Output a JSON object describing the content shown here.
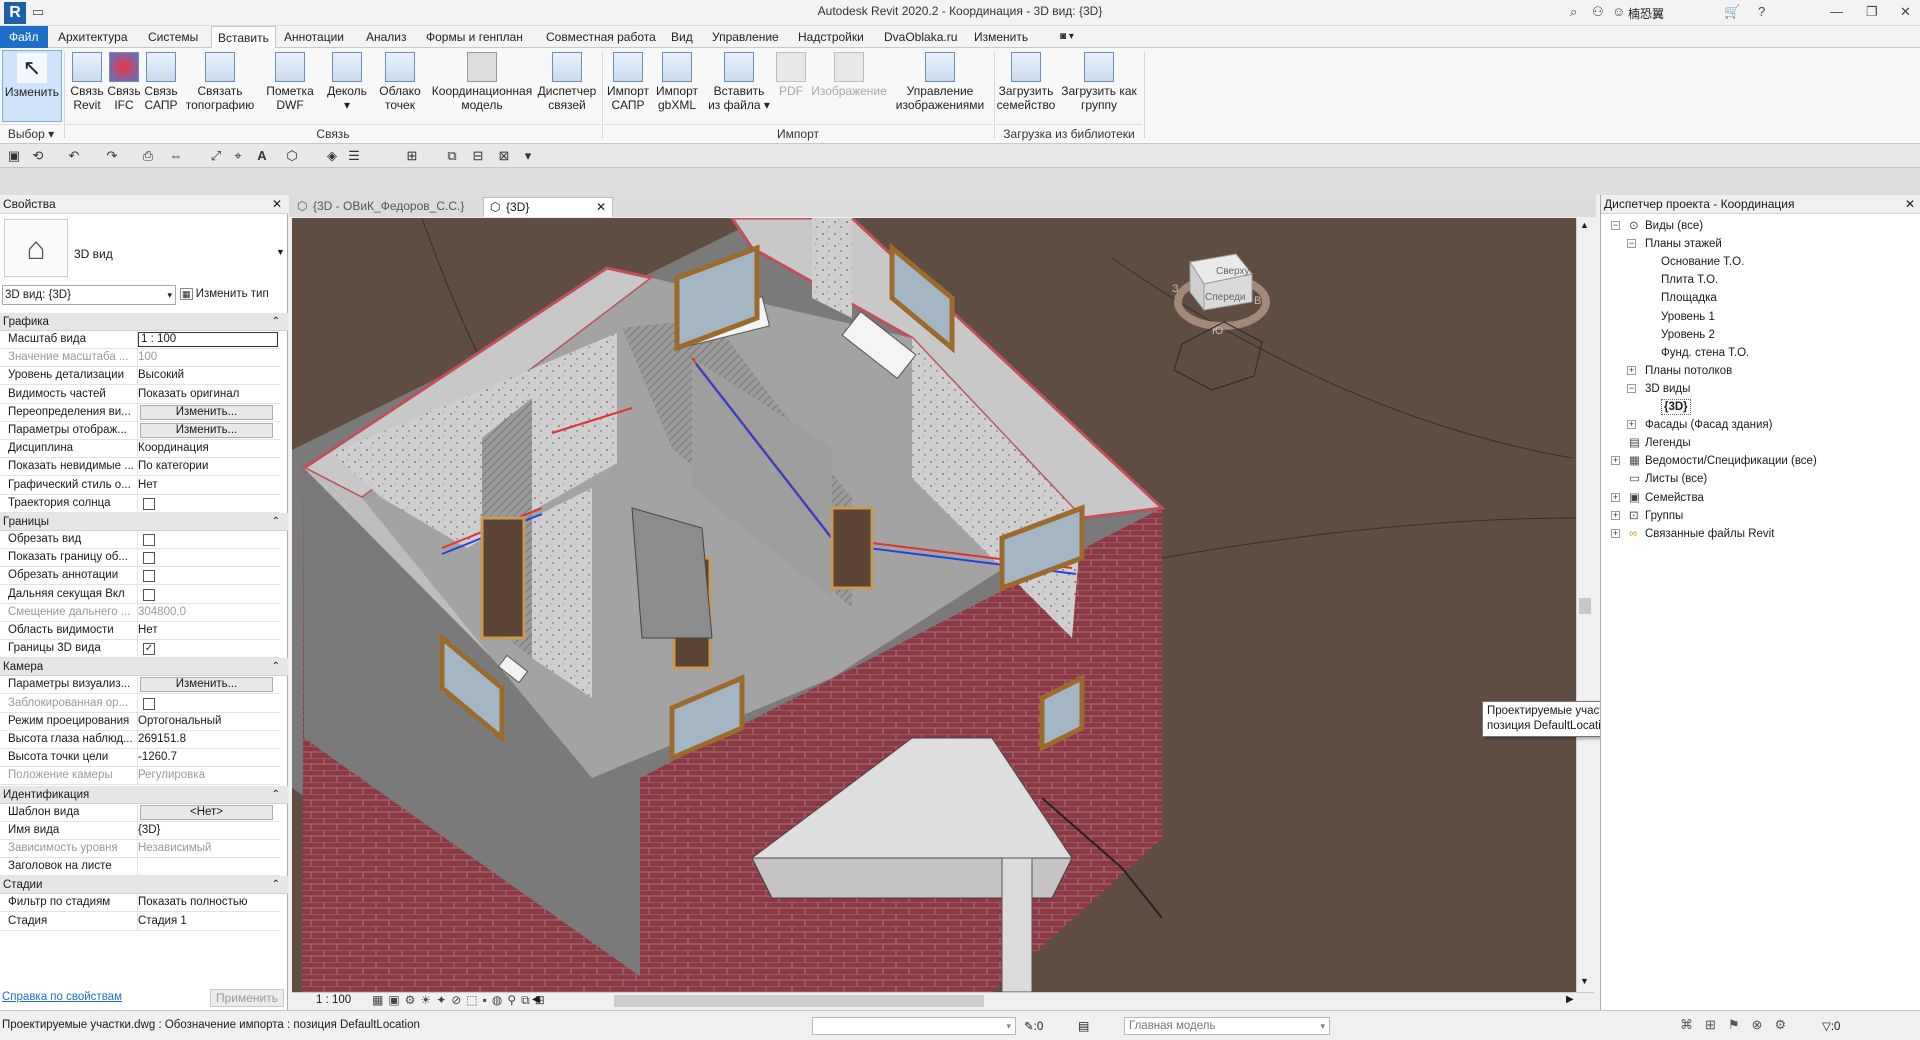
{
  "title_bar": {
    "app_logo": "R",
    "title": "Autodesk Revit 2020.2 - Координация - 3D вид: {3D}",
    "user": "楠恐翼"
  },
  "ribbon_tabs": [
    "Файл",
    "Архитектура",
    "Системы",
    "Вставить",
    "Аннотации",
    "Анализ",
    "Формы и генплан",
    "Совместная работа",
    "Вид",
    "Управление",
    "Надстройки",
    "DvaOblaka.ru",
    "Изменить"
  ],
  "active_tab": "Вставить",
  "ribbon": {
    "modify": "Изменить",
    "select_group": "Выбор",
    "link_revit": "Связь Revit",
    "link_ifc": "Связь IFC",
    "link_cad": "Связь САПР",
    "link_topo": "Связать топографию",
    "dwf_markup": "Пометка DWF",
    "decal": "Деколь",
    "point_cloud": "Облако точек",
    "coordination_model": "Координационная модель",
    "manage_links": "Диспетчер связей",
    "link_group": "Связь",
    "import_cad": "Импорт САПР",
    "import_gbxml": "Импорт gbXML",
    "insert_from_file": "Вставить из файла",
    "pdf": "PDF",
    "image": "Изображение",
    "manage_images": "Управление изображениями",
    "import_group": "Импорт",
    "load_family": "Загрузить семейство",
    "load_as_group": "Загрузить как группу",
    "library_group": "Загрузка из библиотеки"
  },
  "properties": {
    "title": "Свойства",
    "type_name": "3D вид",
    "selector": "3D вид: {3D}",
    "edit_type": "Изменить тип",
    "help_link": "Справка по свойствам",
    "apply": "Применить",
    "categories": [
      {
        "name": "Графика",
        "rows": [
          {
            "k": "Масштаб вида",
            "v": "1 : 100",
            "type": "input"
          },
          {
            "k": "Значение масштаба ...",
            "v": "100",
            "gray": true
          },
          {
            "k": "Уровень детализации",
            "v": "Высокий"
          },
          {
            "k": "Видимость частей",
            "v": "Показать оригинал"
          },
          {
            "k": "Переопределения ви...",
            "v": "Изменить...",
            "type": "button"
          },
          {
            "k": "Параметры отображ...",
            "v": "Изменить...",
            "type": "button"
          },
          {
            "k": "Дисциплина",
            "v": "Координация"
          },
          {
            "k": "Показать невидимые ...",
            "v": "По категории"
          },
          {
            "k": "Графический стиль о...",
            "v": "Нет"
          },
          {
            "k": "Траектория солнца",
            "v": "",
            "type": "check",
            "checked": false
          }
        ]
      },
      {
        "name": "Границы",
        "rows": [
          {
            "k": "Обрезать вид",
            "v": "",
            "type": "check",
            "checked": false
          },
          {
            "k": "Показать границу об...",
            "v": "",
            "type": "check",
            "checked": false
          },
          {
            "k": "Обрезать аннотации",
            "v": "",
            "type": "check",
            "checked": false
          },
          {
            "k": "Дальняя секущая Вкл",
            "v": "",
            "type": "check",
            "checked": false
          },
          {
            "k": "Смещение дальнего ...",
            "v": "304800.0",
            "gray": true
          },
          {
            "k": "Область видимости",
            "v": "Нет"
          },
          {
            "k": "Границы 3D вида",
            "v": "",
            "type": "check",
            "checked": true
          }
        ]
      },
      {
        "name": "Камера",
        "rows": [
          {
            "k": "Параметры визуализ...",
            "v": "Изменить...",
            "type": "button"
          },
          {
            "k": "Заблокированная ор...",
            "v": "",
            "type": "check",
            "checked": false,
            "gray": true
          },
          {
            "k": "Режим проецирования",
            "v": "Ортогональный"
          },
          {
            "k": "Высота глаза наблюд...",
            "v": "269151.8"
          },
          {
            "k": "Высота точки цели",
            "v": "-1260.7"
          },
          {
            "k": "Положение камеры",
            "v": "Регулировка",
            "gray": true
          }
        ]
      },
      {
        "name": "Идентификация",
        "rows": [
          {
            "k": "Шаблон вида",
            "v": "<Нет>",
            "type": "button"
          },
          {
            "k": "Имя вида",
            "v": "{3D}"
          },
          {
            "k": "Зависимость уровня",
            "v": "Независимый",
            "gray": true
          },
          {
            "k": "Заголовок на листе",
            "v": ""
          }
        ]
      },
      {
        "name": "Стадии",
        "rows": [
          {
            "k": "Фильтр по стадиям",
            "v": "Показать полностью"
          },
          {
            "k": "Стадия",
            "v": "Стадия 1"
          }
        ]
      }
    ]
  },
  "view_tabs": [
    {
      "label": "{3D - ОВиК_Федоров_С.С.}",
      "active": false
    },
    {
      "label": "{3D}",
      "active": true
    }
  ],
  "viewcube": {
    "top": "Сверху",
    "front": "Спереди",
    "east": "В",
    "west": "З",
    "south": "Ю"
  },
  "tooltip": "Проектируемые участки.dwg : Обозначение импорта : позиция DefaultLocation",
  "view_scale": "1 : 100",
  "project_browser": {
    "title": "Диспетчер проекта - Координация",
    "tree": [
      {
        "label": "Виды (все)",
        "level": 0,
        "exp": "-",
        "icon": "views"
      },
      {
        "label": "Планы этажей",
        "level": 1,
        "exp": "-"
      },
      {
        "label": "Основание Т.О.",
        "level": 2
      },
      {
        "label": "Плита Т.О.",
        "level": 2
      },
      {
        "label": "Площадка",
        "level": 2
      },
      {
        "label": "Уровень 1",
        "level": 2
      },
      {
        "label": "Уровень 2",
        "level": 2
      },
      {
        "label": "Фунд. стена Т.О.",
        "level": 2
      },
      {
        "label": "Планы потолков",
        "level": 1,
        "exp": "+"
      },
      {
        "label": "3D виды",
        "level": 1,
        "exp": "-"
      },
      {
        "label": "{3D}",
        "level": 2,
        "bold": true
      },
      {
        "label": "Фасады (Фасад здания)",
        "level": 1,
        "exp": "+"
      },
      {
        "label": "Легенды",
        "level": 0,
        "icon": "legend"
      },
      {
        "label": "Ведомости/Спецификации (все)",
        "level": 0,
        "exp": "+",
        "icon": "schedule"
      },
      {
        "label": "Листы (все)",
        "level": 0,
        "icon": "sheet"
      },
      {
        "label": "Семейства",
        "level": 0,
        "exp": "+",
        "icon": "family"
      },
      {
        "label": "Группы",
        "level": 0,
        "exp": "+",
        "icon": "group"
      },
      {
        "label": "Связанные файлы Revit",
        "level": 0,
        "exp": "+",
        "icon": "link"
      }
    ]
  },
  "status": {
    "message": "Проектируемые участки.dwg : Обозначение импорта : позиция DefaultLocation",
    "count1": ":0",
    "model": "Главная модель",
    "count2": ":0"
  }
}
